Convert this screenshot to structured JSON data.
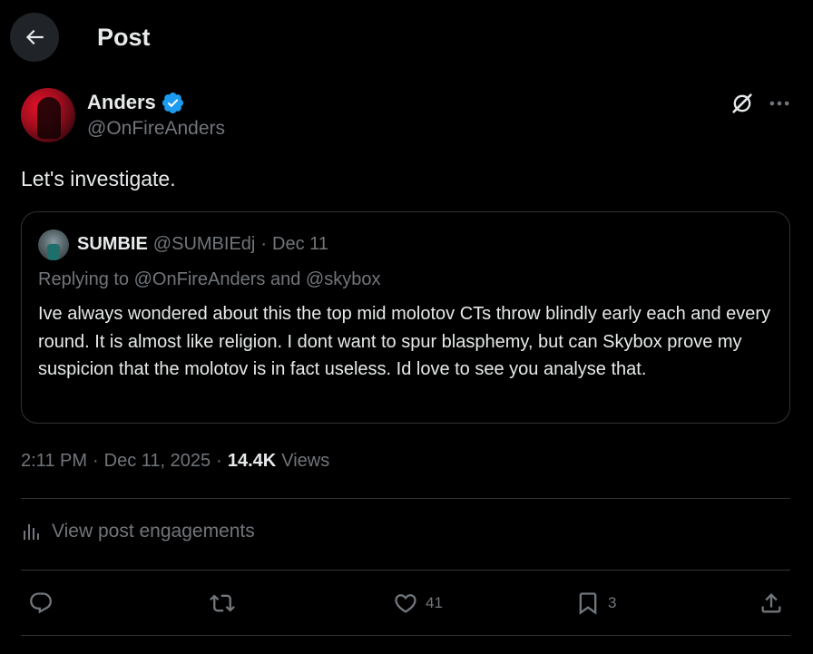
{
  "header": {
    "title": "Post"
  },
  "author": {
    "name": "Anders",
    "handle": "@OnFireAnders",
    "verified": true
  },
  "tweet": {
    "text": "Let's investigate."
  },
  "quote": {
    "name": "SUMBIE",
    "handle": "@SUMBIEdj",
    "separator": "·",
    "date": "Dec 11",
    "replying_to": "Replying to @OnFireAnders and @skybox",
    "body": "Ive always wondered about this the top mid molotov CTs throw blindly early each and every round. It is almost like religion. I dont want to spur blasphemy, but can Skybox prove my suspicion that the molotov is in fact useless. Id love to see you analyse that."
  },
  "meta": {
    "time": "2:11 PM",
    "separator": "·",
    "date": "Dec 11, 2025",
    "views_count": "14.4K",
    "views_label": "Views"
  },
  "engagements": {
    "label": "View post engagements"
  },
  "actions": {
    "reply_count": "",
    "repost_count": "",
    "like_count": "41",
    "bookmark_count": "3"
  },
  "icons": {
    "back": "arrow-left-icon",
    "verified": "verified-badge-icon",
    "grok": "grok-icon",
    "more": "more-horizontal-icon",
    "engagements": "bar-chart-icon",
    "reply": "reply-icon",
    "repost": "repost-icon",
    "like": "heart-icon",
    "bookmark": "bookmark-icon",
    "share": "share-icon"
  },
  "colors": {
    "background": "#000000",
    "text_primary": "#e7e9ea",
    "text_secondary": "#71767b",
    "border": "#2f3336",
    "verified": "#1d9bf0"
  }
}
